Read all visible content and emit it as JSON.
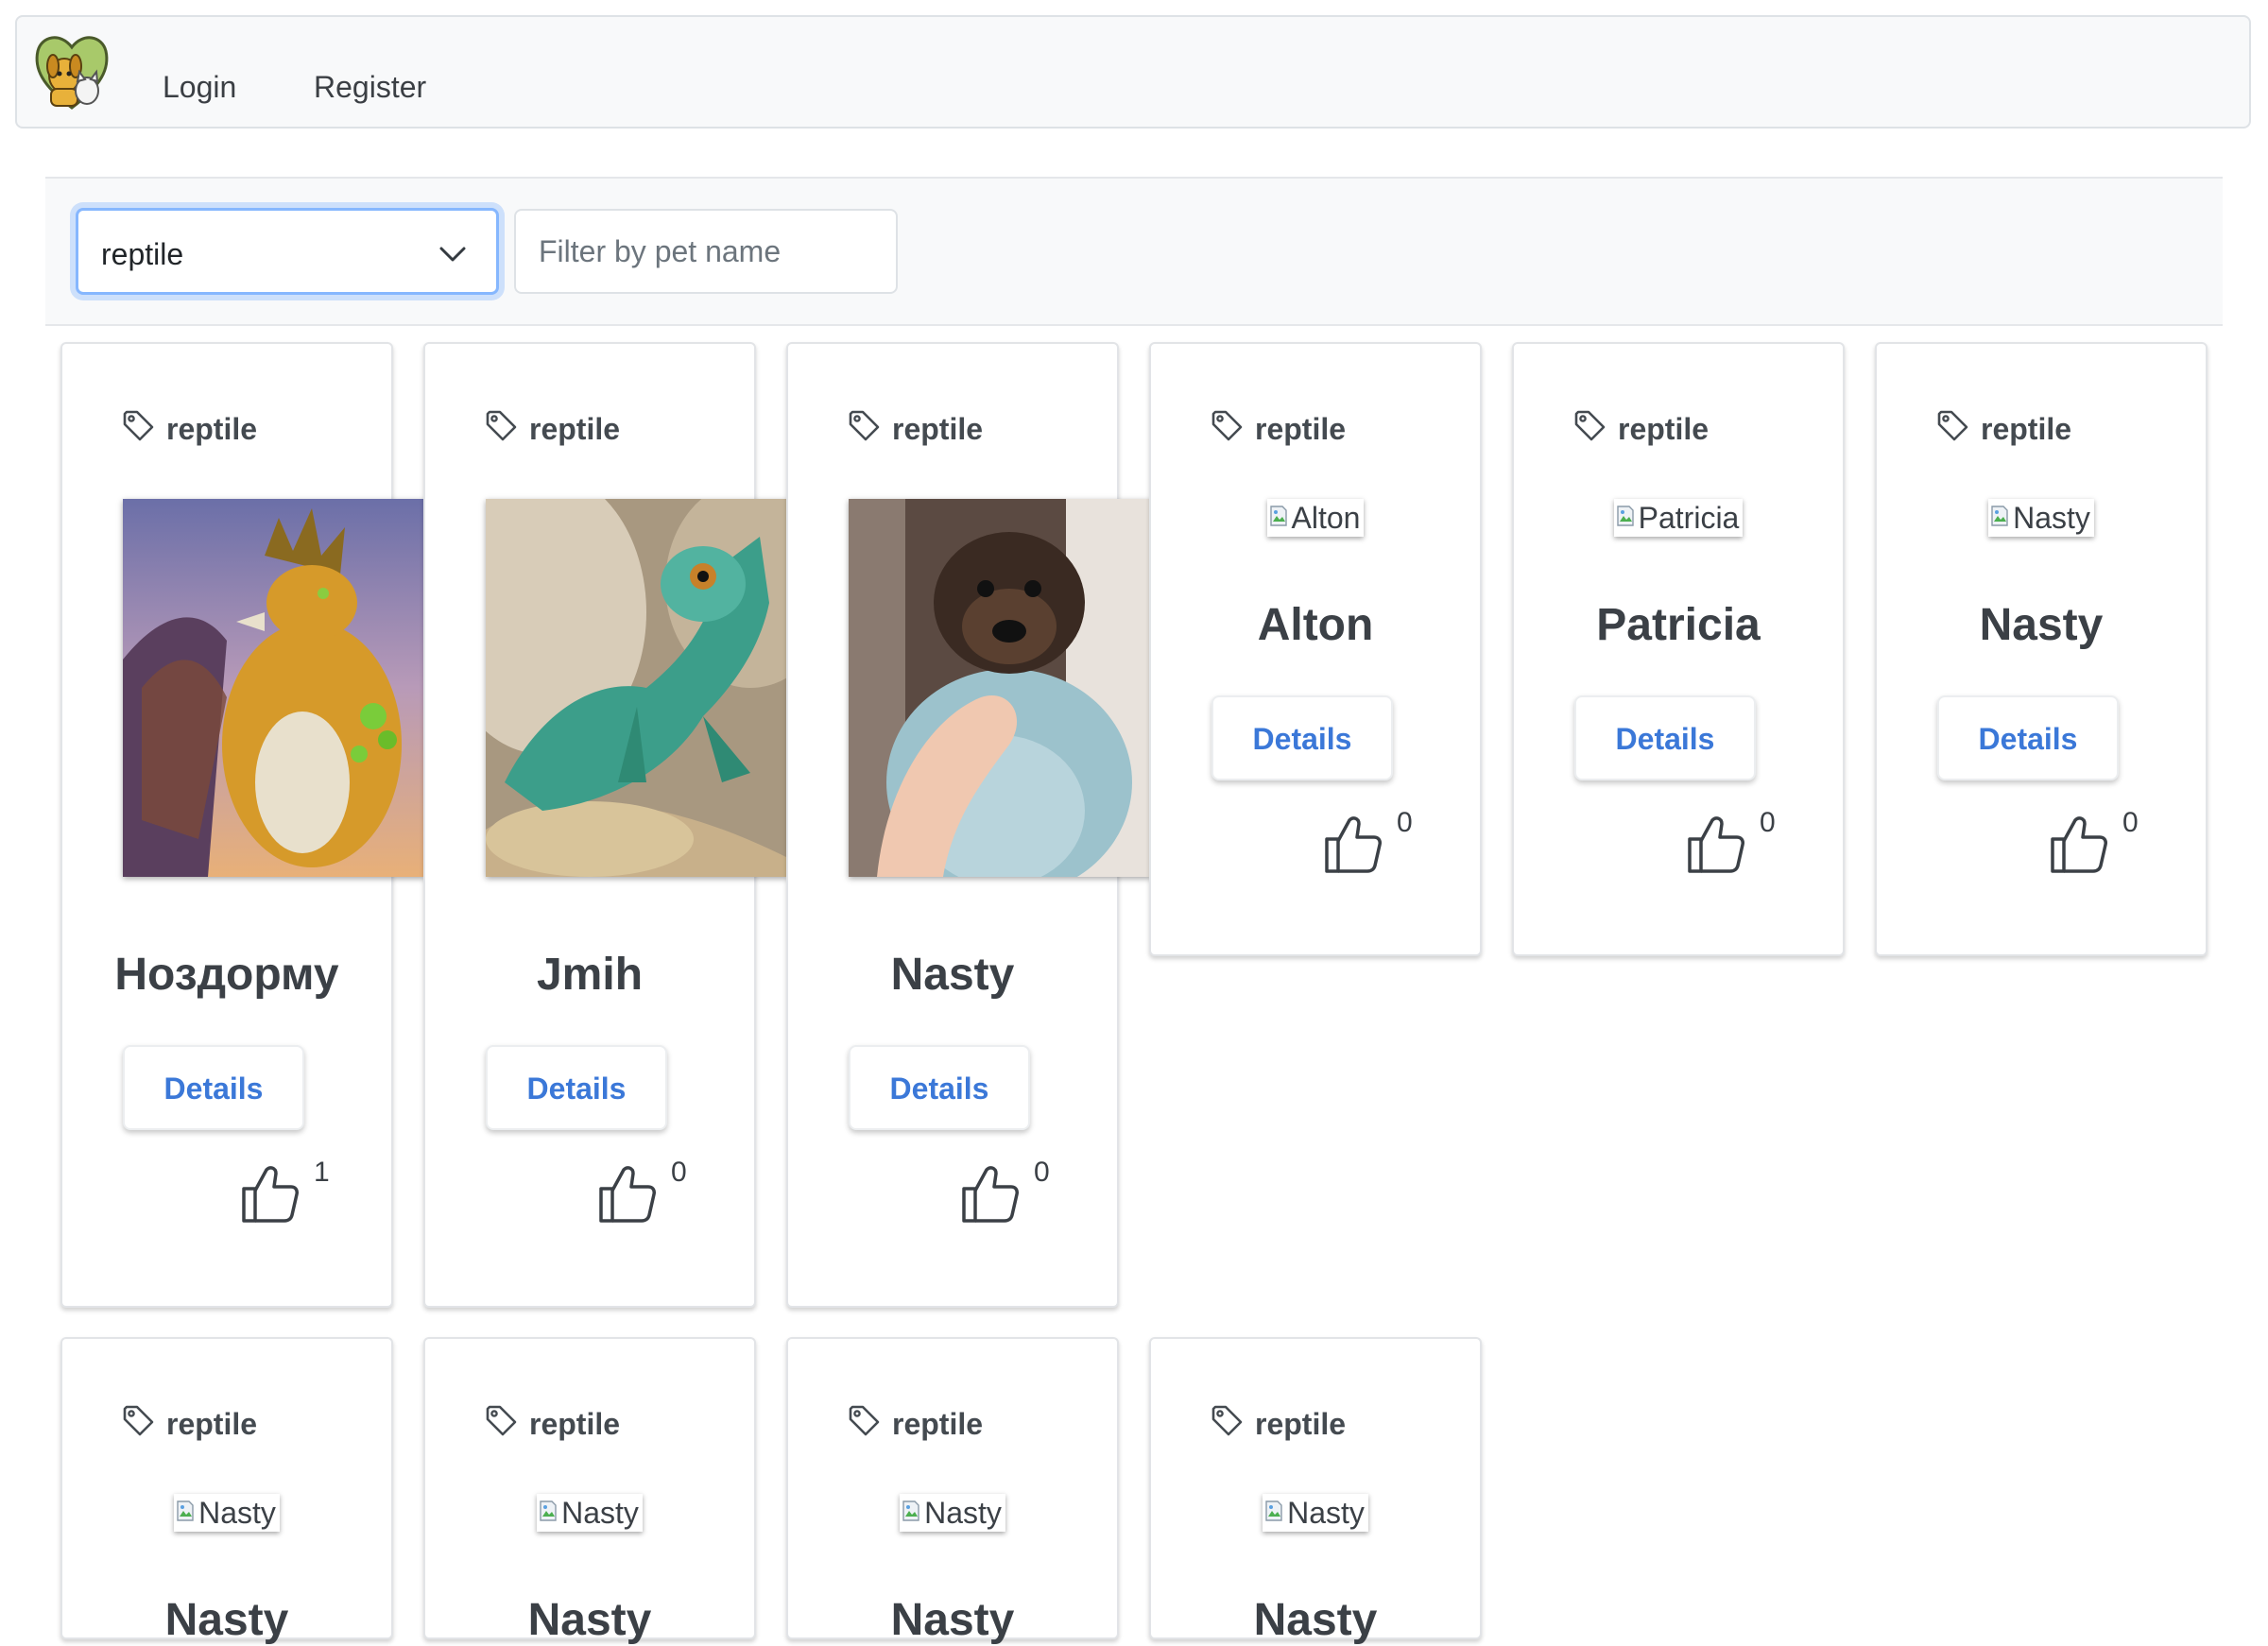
{
  "navbar": {
    "login_label": "Login",
    "register_label": "Register"
  },
  "filters": {
    "category_value": "reptile",
    "name_placeholder": "Filter by pet name"
  },
  "cards": [
    {
      "tag": "reptile",
      "name": "Ноздорму",
      "alt": "",
      "likes": "1",
      "photo": "dragon"
    },
    {
      "tag": "reptile",
      "name": "Jmih",
      "alt": "",
      "likes": "0",
      "photo": "lizard"
    },
    {
      "tag": "reptile",
      "name": "Nasty",
      "alt": "",
      "likes": "0",
      "photo": "dog"
    },
    {
      "tag": "reptile",
      "name": "Alton",
      "alt": "Alton",
      "likes": "0",
      "photo": null
    },
    {
      "tag": "reptile",
      "name": "Patricia",
      "alt": "Patricia",
      "likes": "0",
      "photo": null
    },
    {
      "tag": "reptile",
      "name": "Nasty",
      "alt": "Nasty",
      "likes": "0",
      "photo": null
    },
    {
      "tag": "reptile",
      "name": "Nasty",
      "alt": "Nasty",
      "likes": "",
      "photo": null
    },
    {
      "tag": "reptile",
      "name": "Nasty",
      "alt": "Nasty",
      "likes": "",
      "photo": null
    },
    {
      "tag": "reptile",
      "name": "Nasty",
      "alt": "Nasty",
      "likes": "",
      "photo": null
    },
    {
      "tag": "reptile",
      "name": "Nasty",
      "alt": "Nasty",
      "likes": "",
      "photo": null
    }
  ],
  "details_label": "Details",
  "colors": {
    "link": "#3b78d8",
    "navbar_bg": "#f8f9fa",
    "focus_border": "#86b7fe"
  }
}
